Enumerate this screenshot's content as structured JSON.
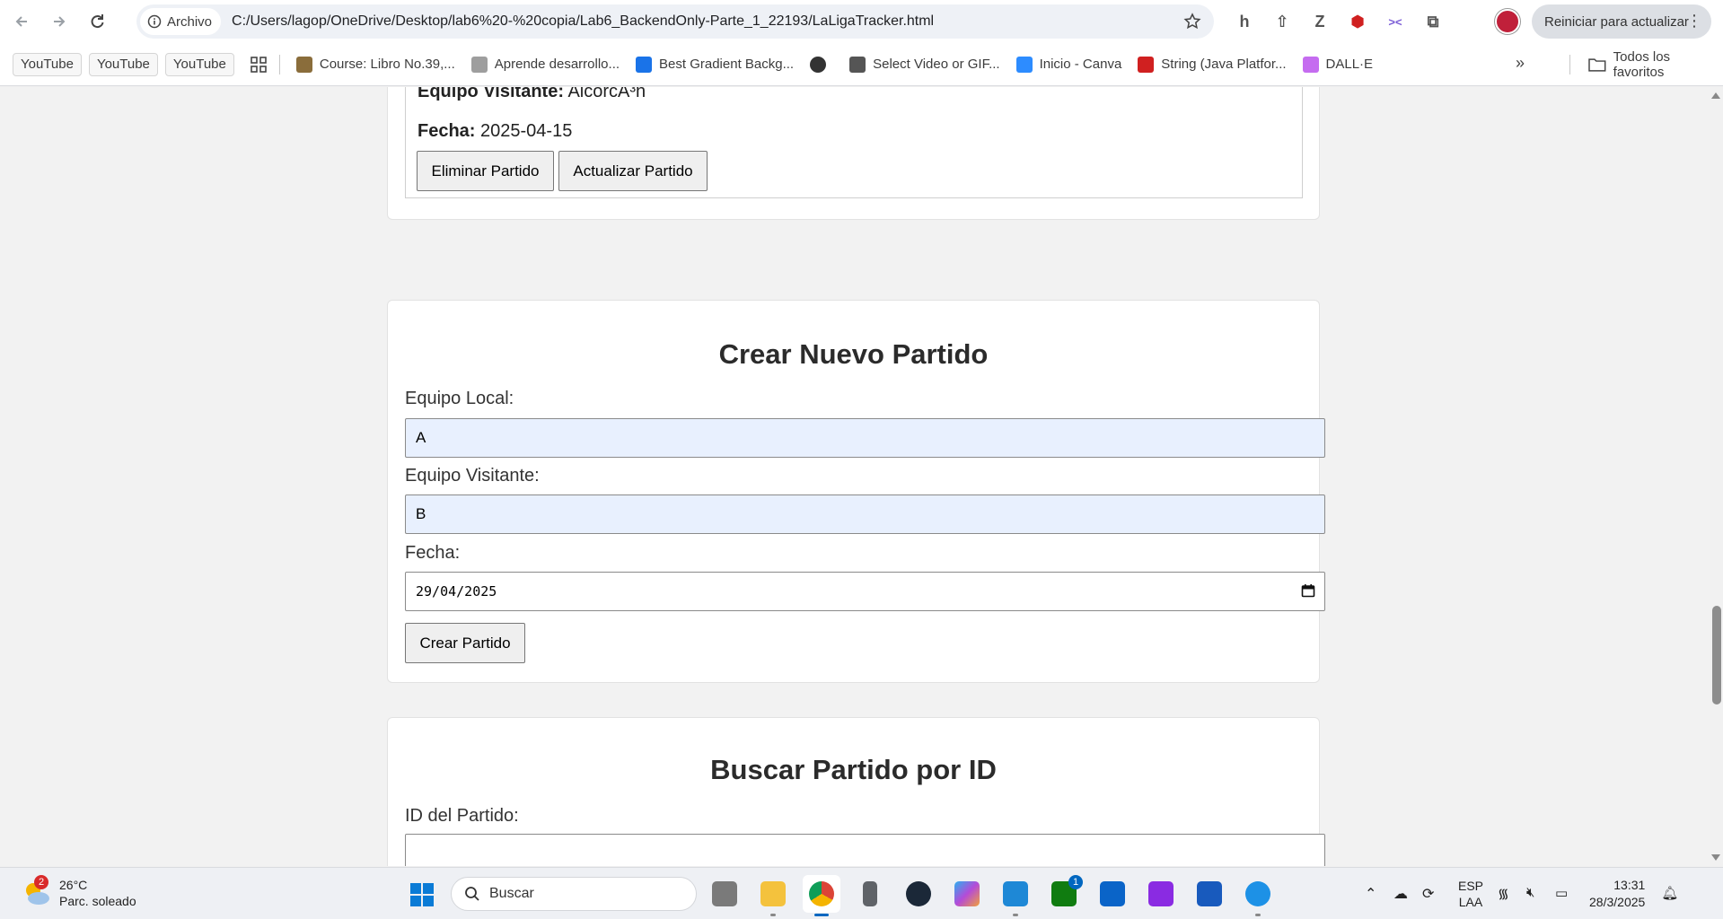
{
  "browser": {
    "security_chip": "Archivo",
    "url": "C:/Users/lagop/OneDrive/Desktop/lab6%20-%20copia/Lab6_BackendOnly-Parte_1_22193/LaLigaTracker.html",
    "update_button": "Reiniciar para actualizar"
  },
  "bookmarks": {
    "yt1": "YouTube",
    "yt2": "YouTube",
    "yt3": "YouTube",
    "items": [
      {
        "label": "Course: Libro No.39,...",
        "color": "#8a6d3b"
      },
      {
        "label": "Aprende desarrollo...",
        "color": "#9e9e9e"
      },
      {
        "label": "Best Gradient Backg...",
        "color": "#1a73e8"
      },
      {
        "label": "",
        "color": "#333333"
      },
      {
        "label": "Select Video or GIF...",
        "color": "#555555"
      },
      {
        "label": "Inicio - Canva",
        "color": "#2d8cff"
      },
      {
        "label": "String (Java Platfor...",
        "color": "#d02020"
      },
      {
        "label": "DALL·E",
        "color": "#c56cf0"
      }
    ],
    "all_favorites": "Todos los favoritos"
  },
  "match_card": {
    "visitor_label": "Equipo Visitante:",
    "visitor_value": "AlcorcÃ³n",
    "date_label": "Fecha:",
    "date_value": "2025-04-15",
    "delete_button": "Eliminar Partido",
    "update_button": "Actualizar Partido"
  },
  "create_form": {
    "title": "Crear Nuevo Partido",
    "home_label": "Equipo Local:",
    "home_value": "A",
    "visitor_label": "Equipo Visitante:",
    "visitor_value": "B",
    "date_label": "Fecha:",
    "date_value": "29/04/2025",
    "submit_button": "Crear Partido"
  },
  "search_form": {
    "title": "Buscar Partido por ID",
    "id_label": "ID del Partido:",
    "id_value": ""
  },
  "taskbar": {
    "weather_badge": "2",
    "temperature": "26°C",
    "condition": "Parc. soleado",
    "search_placeholder": "Buscar",
    "lang_top": "ESP",
    "lang_bottom": "LAA",
    "time": "13:31",
    "date": "28/3/2025",
    "teams_badge": "1"
  },
  "colors": {
    "autofill_bg": "#e8f0fe",
    "taskbar_accent": "#0067c0"
  }
}
